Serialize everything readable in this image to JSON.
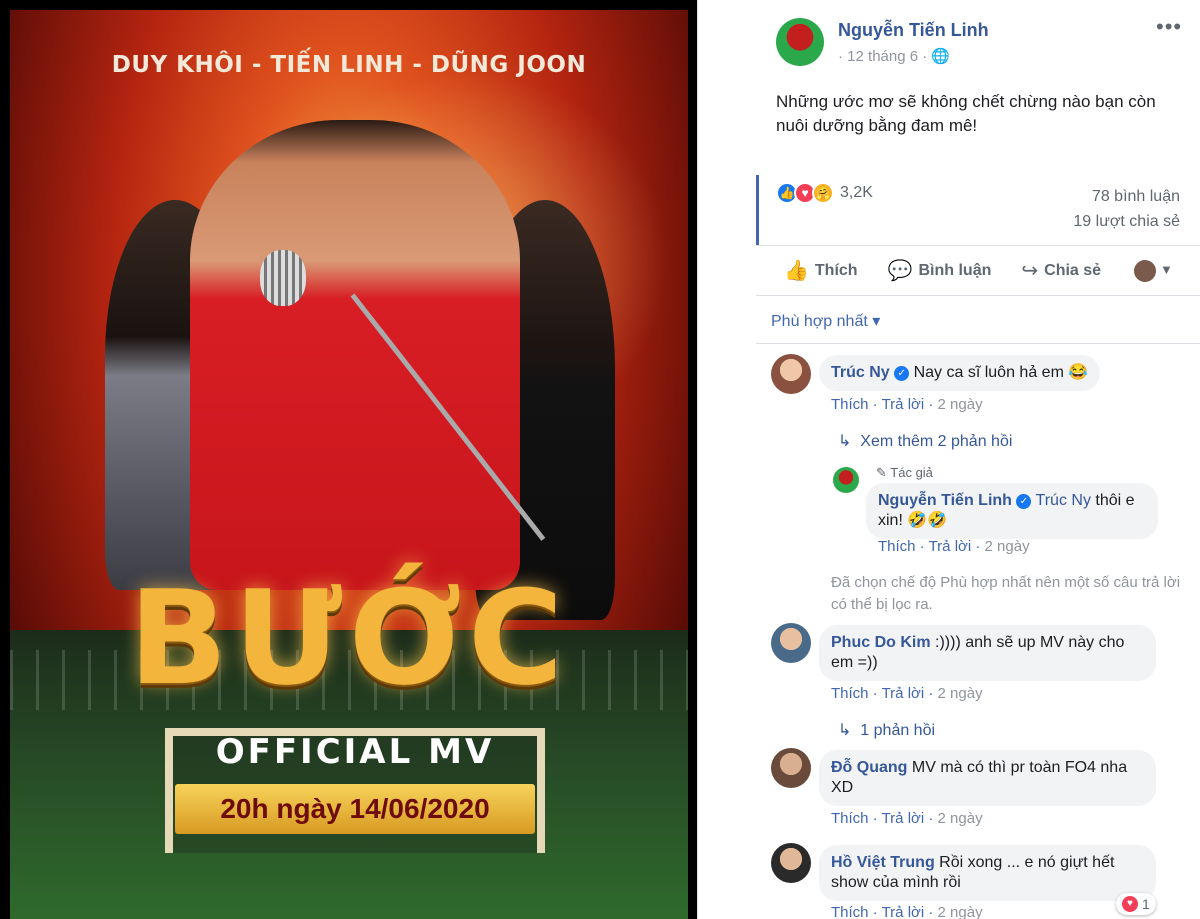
{
  "poster": {
    "names": "DUY KHÔI - TIẾN LINH - DŨNG JOON",
    "title": "BƯỚC",
    "official": "OFFICIAL MV",
    "date": "20h ngày 14/06/2020"
  },
  "post": {
    "author": "Nguyễn Tiến Linh",
    "date": "12 tháng 6",
    "privacy_icon": "globe-icon",
    "text": "Những ước mơ sẽ không chết chừng nào bạn còn nuôi dưỡng bằng đam mê!",
    "reaction_count": "3,2K",
    "comments_count": "78 bình luận",
    "shares_count": "19 lượt chia sẻ",
    "actions": {
      "like": "Thích",
      "comment": "Bình luận",
      "share": "Chia sẻ"
    },
    "sort_label": "Phù hợp nhất"
  },
  "comments": [
    {
      "name": "Trúc Ny",
      "text": "Nay ca sĩ luôn hả em 😂",
      "like": "Thích",
      "reply": "Trả lời",
      "time": "2 ngày",
      "more_replies": "Xem thêm 2 phản hồi"
    },
    {
      "author_label": "Tác giả",
      "name": "Nguyễn Tiến Linh",
      "tag": "Trúc Ny",
      "text1": " thôi e",
      "text2": "xin! 🤣🤣",
      "like": "Thích",
      "reply": "Trả lời",
      "time": "2 ngày"
    },
    {
      "filter_note": "Đã chọn chế độ Phù hợp nhất nên một số câu trả lời có thể bị lọc ra."
    },
    {
      "name": "Phuc Do Kim",
      "text1": " :)))) anh sẽ up MV này cho",
      "text2": "em =))",
      "like": "Thích",
      "reply": "Trả lời",
      "time": "2 ngày",
      "more_replies": "1 phản hồi"
    },
    {
      "name": "Đỗ Quang",
      "text1": " MV mà có thì pr toàn FO4 nha",
      "text2": "XD",
      "like": "Thích",
      "reply": "Trả lời",
      "time": "2 ngày"
    },
    {
      "name": "Hồ Việt Trung",
      "text1": " Rồi xong ... e nó giựt hết",
      "text2": "show của mình rồi",
      "like": "Thích",
      "reply": "Trả lời",
      "time": "2 ngày",
      "reactions": "1"
    }
  ],
  "colors": {
    "link": "#365899",
    "fb_blue": "#4267b2",
    "muted": "#90949c",
    "bubble": "#f2f3f5"
  }
}
